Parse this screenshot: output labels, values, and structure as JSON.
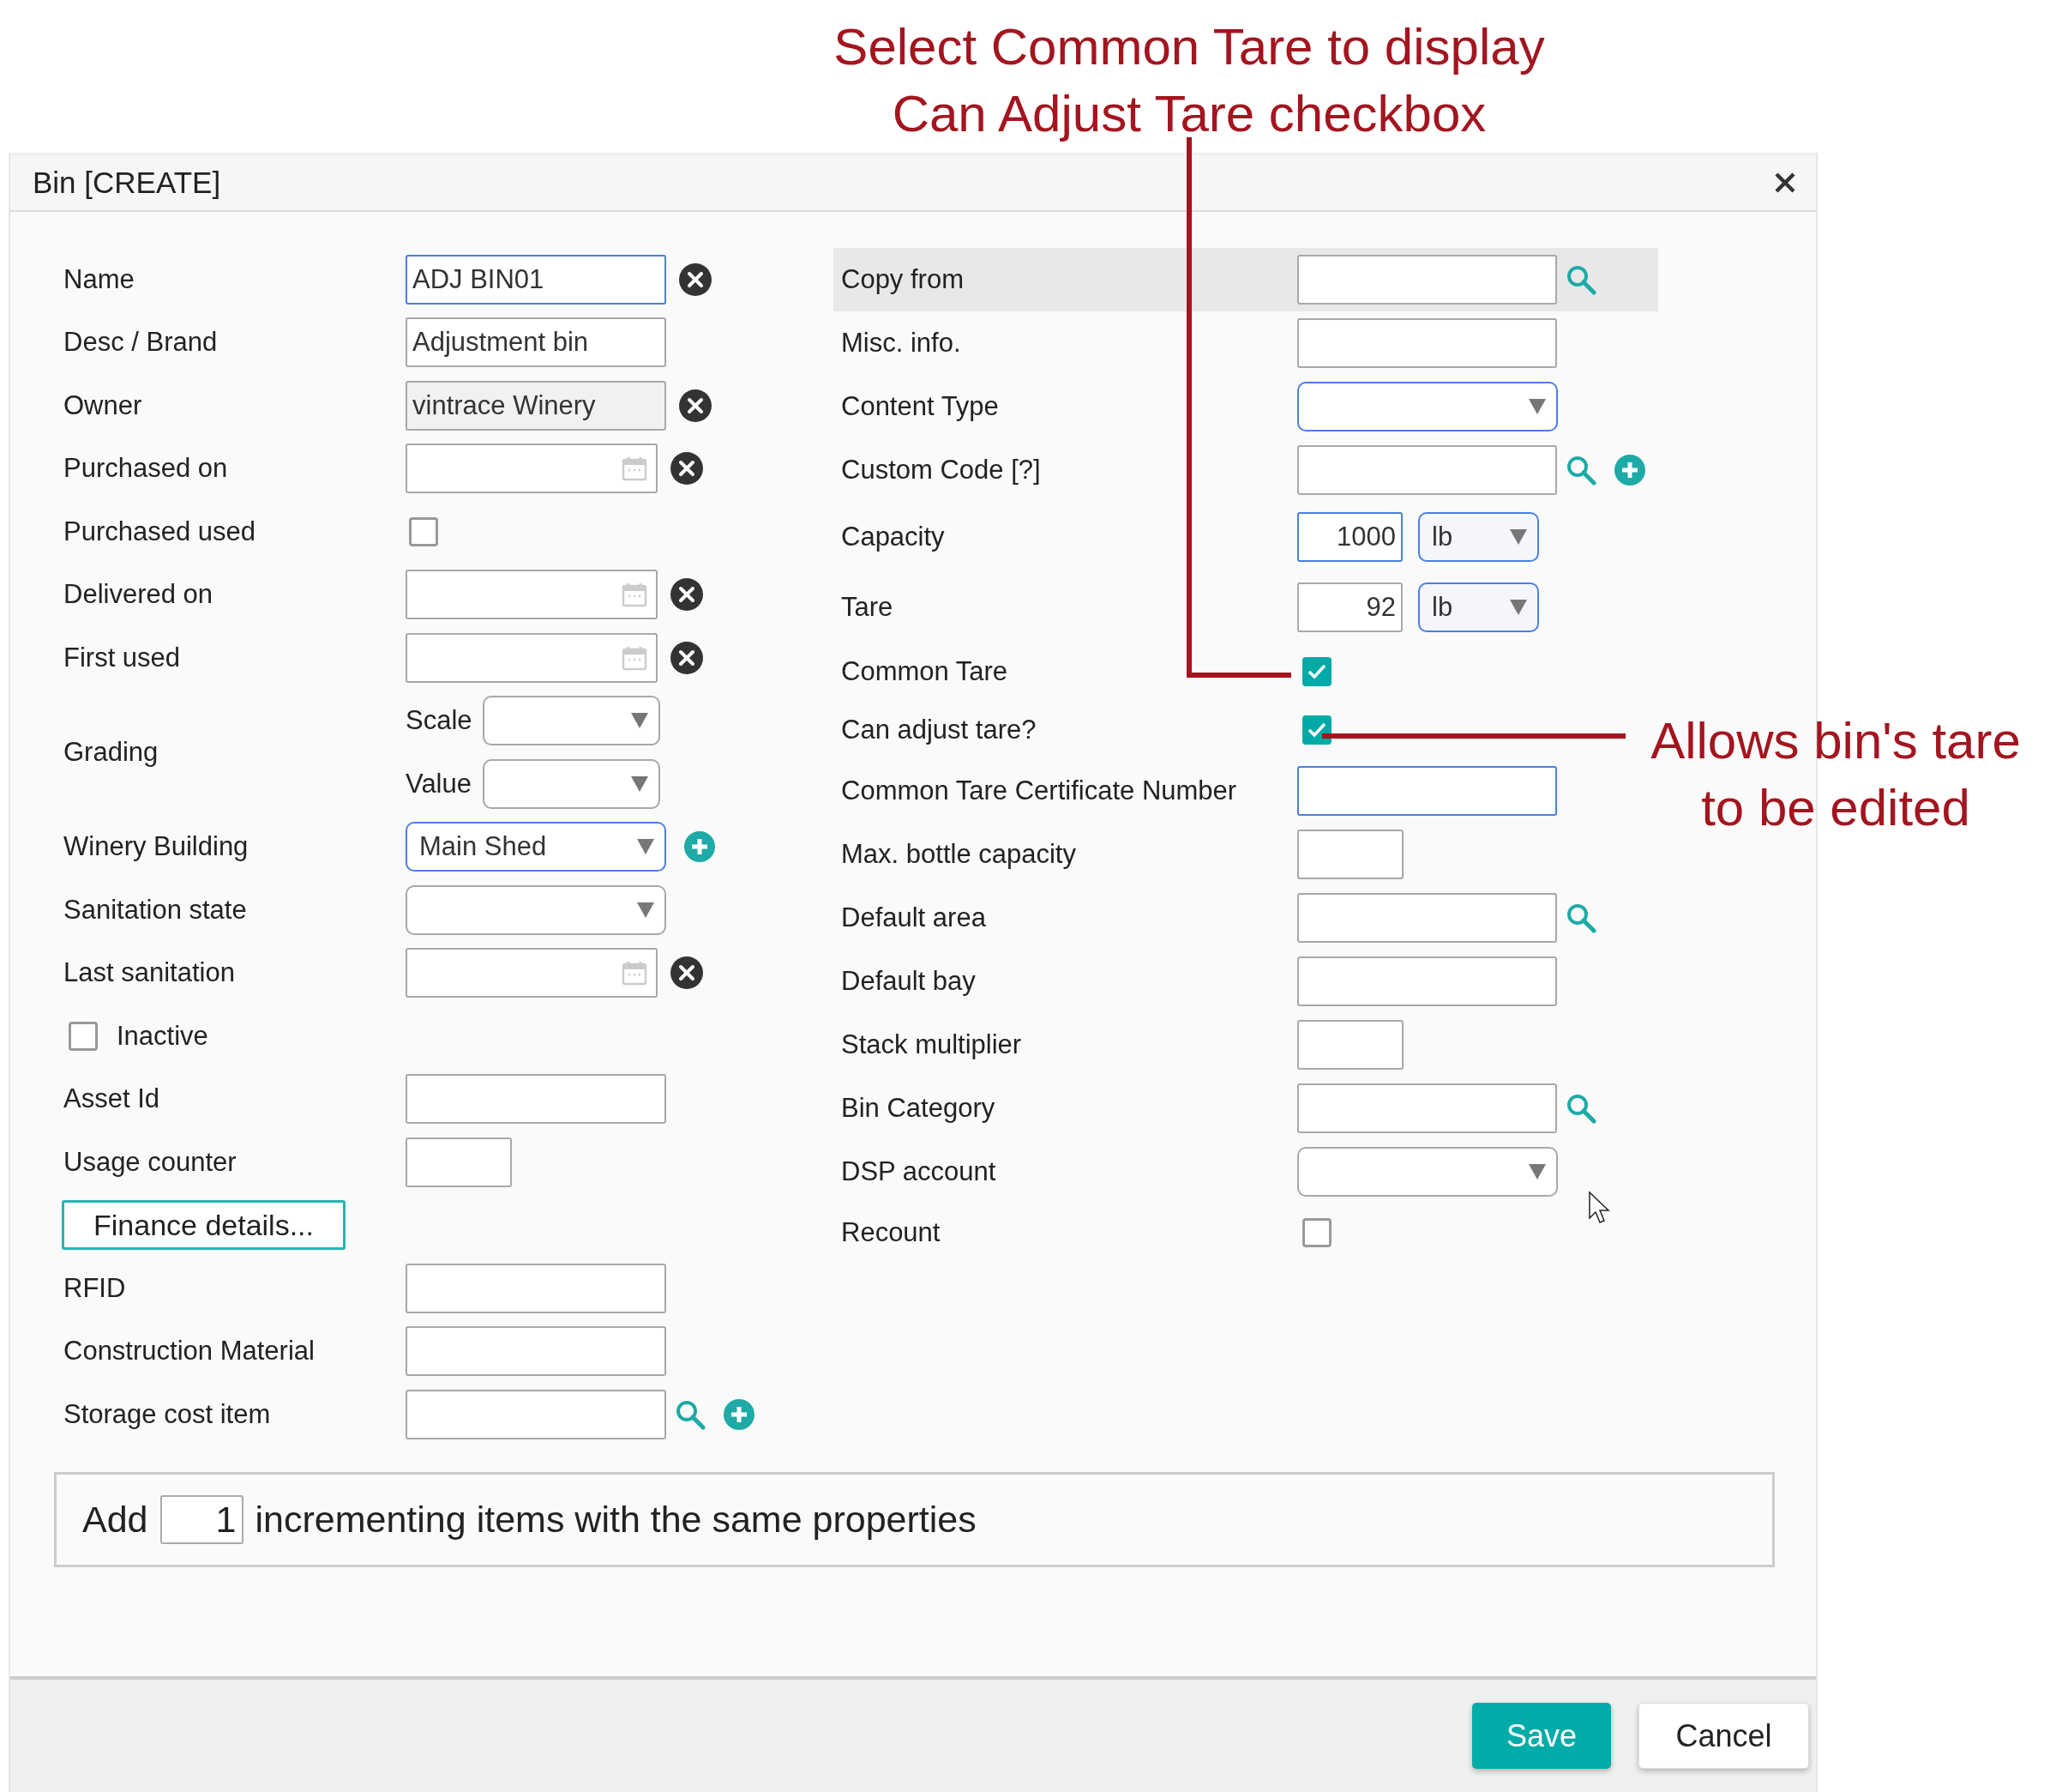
{
  "annotations": [
    {
      "kind": "top",
      "lines": [
        "Select Common Tare to display",
        "Can Adjust Tare checkbox"
      ]
    },
    {
      "kind": "side",
      "lines": [
        "Allows bin's tare",
        "to be edited"
      ]
    }
  ],
  "dialog": {
    "title": "Bin [CREATE]",
    "left_fields": [
      {
        "kind": "text",
        "label": "Name",
        "value": "ADJ BIN01",
        "highlighted": true,
        "disabled": false,
        "icons": [
          {
            "kind": "clear"
          }
        ]
      },
      {
        "kind": "text",
        "label": "Desc / Brand",
        "value": "Adjustment bin",
        "highlighted": false,
        "disabled": false
      },
      {
        "kind": "text",
        "label": "Owner",
        "value": "vintrace Winery",
        "highlighted": false,
        "disabled": true,
        "icons": [
          {
            "kind": "clear"
          }
        ]
      },
      {
        "kind": "date",
        "label": "Purchased on",
        "icons": [
          {
            "kind": "clear"
          }
        ]
      },
      {
        "kind": "checkbox",
        "label": "Purchased used",
        "checked": false
      },
      {
        "kind": "date",
        "label": "Delivered on",
        "icons": [
          {
            "kind": "clear"
          }
        ]
      },
      {
        "kind": "date",
        "label": "First used",
        "icons": [
          {
            "kind": "clear"
          }
        ]
      },
      {
        "kind": "grading",
        "label": "Grading",
        "parts": [
          {
            "label": "Scale"
          },
          {
            "label": "Value"
          }
        ]
      },
      {
        "kind": "select",
        "label": "Winery Building",
        "value": "Main Shed",
        "highlighted": true,
        "icons": [
          {
            "kind": "add"
          }
        ]
      },
      {
        "kind": "select",
        "label": "Sanitation state",
        "highlighted": false
      },
      {
        "kind": "date",
        "label": "Last sanitation",
        "icons": [
          {
            "kind": "clear"
          }
        ]
      },
      {
        "kind": "checkbox-first",
        "label": "Inactive",
        "checked": false
      },
      {
        "kind": "text",
        "label": "Asset Id",
        "highlighted": false,
        "disabled": false
      },
      {
        "kind": "number",
        "label": "Usage counter"
      },
      {
        "kind": "button",
        "label": "Finance details..."
      },
      {
        "kind": "text",
        "label": "RFID",
        "highlighted": false,
        "disabled": false
      },
      {
        "kind": "text",
        "label": "Construction Material",
        "highlighted": false,
        "disabled": false
      },
      {
        "kind": "text",
        "label": "Storage cost item",
        "highlighted": false,
        "disabled": false,
        "icons": [
          {
            "kind": "search"
          },
          {
            "kind": "add"
          }
        ]
      }
    ],
    "right_fields": [
      {
        "kind": "text",
        "label": "Copy from",
        "selected": true,
        "highlighted": false,
        "icons": [
          {
            "kind": "search"
          }
        ]
      },
      {
        "kind": "text",
        "label": "Misc. info.",
        "selected": false,
        "highlighted": false
      },
      {
        "kind": "select",
        "label": "Content Type",
        "selected": false,
        "highlighted": true
      },
      {
        "kind": "text",
        "label": "Custom Code [?]",
        "selected": false,
        "highlighted": false,
        "icons": [
          {
            "kind": "search"
          },
          {
            "kind": "add"
          }
        ]
      },
      {
        "kind": "quantity",
        "label": "Capacity",
        "selected": false,
        "value": "1000",
        "value_highlighted": true,
        "unit": "lb",
        "unit_highlighted": true
      },
      {
        "kind": "quantity",
        "label": "Tare",
        "selected": false,
        "value": "92",
        "value_highlighted": false,
        "unit": "lb",
        "unit_highlighted": true
      },
      {
        "kind": "checkbox",
        "label": "Common Tare",
        "selected": false,
        "checked": true
      },
      {
        "kind": "checkbox",
        "label": "Can adjust tare?",
        "selected": false,
        "checked": true
      },
      {
        "kind": "text",
        "label": "Common Tare Certificate Number",
        "selected": false,
        "highlighted": true
      },
      {
        "kind": "number",
        "label": "Max. bottle capacity",
        "selected": false
      },
      {
        "kind": "text",
        "label": "Default area",
        "selected": false,
        "highlighted": false,
        "icons": [
          {
            "kind": "search"
          }
        ]
      },
      {
        "kind": "text",
        "label": "Default bay",
        "selected": false,
        "highlighted": false
      },
      {
        "kind": "number",
        "label": "Stack multiplier",
        "selected": false
      },
      {
        "kind": "text",
        "label": "Bin Category",
        "selected": false,
        "highlighted": false,
        "icons": [
          {
            "kind": "search"
          }
        ]
      },
      {
        "kind": "select",
        "label": "DSP account",
        "selected": false,
        "highlighted": false
      },
      {
        "kind": "checkbox",
        "label": "Recount",
        "selected": false,
        "checked": false
      }
    ],
    "add_items": {
      "before": "Add",
      "count": "1",
      "after": "incrementing items with the same properties"
    },
    "buttons": [
      {
        "label": "Save",
        "kind": "primary"
      },
      {
        "label": "Cancel",
        "kind": "secondary"
      }
    ]
  }
}
